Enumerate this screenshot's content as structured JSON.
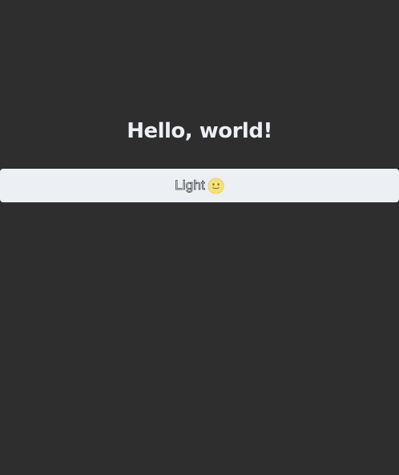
{
  "main": {
    "title": "Hello, world!",
    "theme_toggle": {
      "label": "Light",
      "icon": "smiley-face-icon"
    }
  },
  "colors": {
    "background": "#2e2e2e",
    "title_text": "#eceff4",
    "button_background": "#eceff4",
    "icon_fill": "#f6e27a"
  }
}
